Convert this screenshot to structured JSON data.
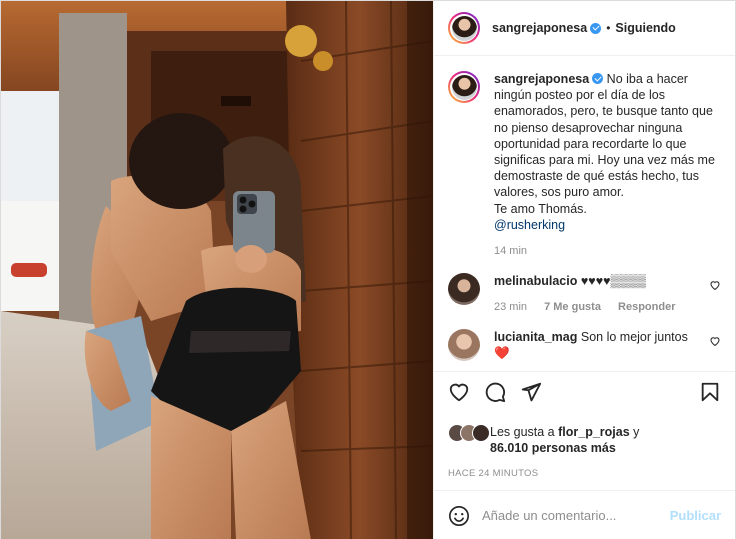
{
  "post": {
    "username": "sangrejaponesa",
    "separator": "•",
    "follow_state": "Siguiendo",
    "caption": {
      "username": "sangrejaponesa",
      "text": "No iba a hacer ningún posteo por el día de los enamorados, pero, te busque tanto que no pienso desaprovechar ninguna oportunidad para recordarte lo que significas para mi. Hoy una vez más me demostraste de qué estás hecho, tus valores, sos puro amor.",
      "closing": "Te amo Thomás.",
      "mention": "@rusherking",
      "time": "14 min"
    },
    "comments": [
      {
        "username": "melinabulacio",
        "text": "♥♥♥♥▒▒▒▒",
        "time": "23 min",
        "likes": "7 Me gusta",
        "reply": "Responder"
      },
      {
        "username": "lucianita_mag",
        "text": "Son lo mejor juntos",
        "emoji": "❤️"
      }
    ],
    "likes": {
      "prefix": "Les gusta a",
      "user": "flor_p_rojas",
      "conjunction": "y",
      "count": "86.010 personas más"
    },
    "timestamp": "HACE 24 MINUTOS",
    "add_comment": {
      "placeholder": "Añade un comentario...",
      "publish": "Publicar"
    }
  },
  "icons": {
    "like": "heart-icon",
    "comment": "comment-icon",
    "share": "share-icon",
    "save": "bookmark-icon",
    "emoji": "emoji-icon"
  },
  "colors": {
    "verified": "#3897f0",
    "link": "#00376b",
    "muted": "#8e8e8e",
    "publish_disabled": "#b2dffc"
  }
}
